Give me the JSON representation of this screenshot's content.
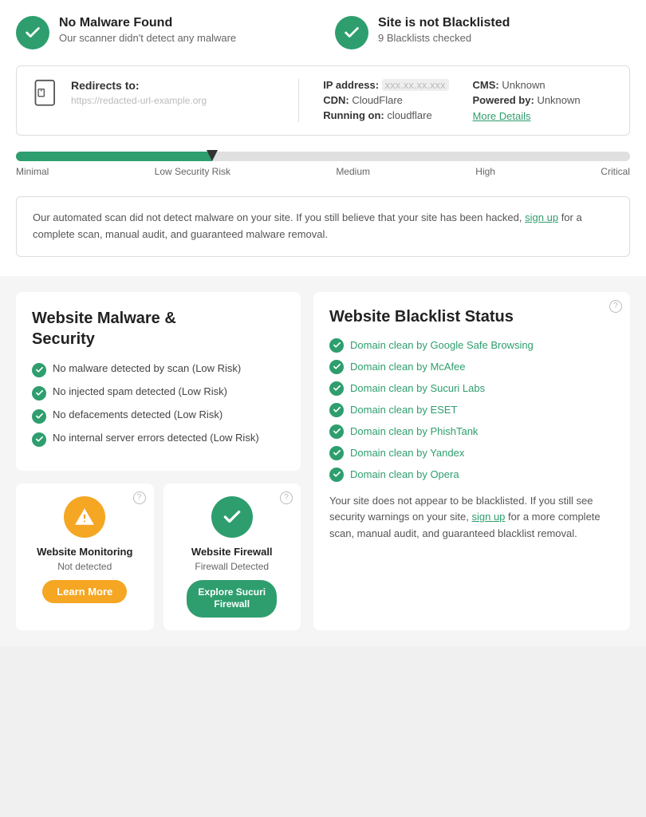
{
  "status_cards": [
    {
      "id": "no-malware",
      "title": "No Malware Found",
      "description": "Our scanner didn't detect any malware"
    },
    {
      "id": "not-blacklisted",
      "title": "Site is not Blacklisted",
      "description": "9 Blacklists checked"
    }
  ],
  "info_box": {
    "redirects_label": "Redirects to:",
    "redirects_url": "https://redacted-url-example.org",
    "ip_label": "IP address:",
    "ip_value": "xxx.xx.xx.xxx",
    "cdn_label": "CDN:",
    "cdn_value": "CloudFlare",
    "running_label": "Running on:",
    "running_value": "cloudflare",
    "cms_label": "CMS:",
    "cms_value": "Unknown",
    "powered_label": "Powered by:",
    "powered_value": "Unknown",
    "more_details": "More Details"
  },
  "risk_meter": {
    "labels": [
      "Minimal",
      "Low Security Risk",
      "Medium",
      "High",
      "Critical"
    ],
    "fill_percent": 32
  },
  "scan_message": {
    "text_before": "Our automated scan did not detect malware on your site. If you still believe that your site has been hacked,",
    "link_text": "sign up",
    "text_after": "for a complete scan, manual audit, and guaranteed malware removal."
  },
  "security_section": {
    "title": "Website Malware &\nSecurity",
    "items": [
      "No malware detected by scan (Low Risk)",
      "No injected spam detected (Low Risk)",
      "No defacements detected (Low Risk)",
      "No internal server errors detected (Low Risk)"
    ]
  },
  "monitoring_card": {
    "title": "Website Monitoring",
    "status": "Not detected",
    "button_label": "Learn More"
  },
  "firewall_card": {
    "title": "Website Firewall",
    "status": "Firewall Detected",
    "button_label": "Explore Sucuri\nFirewall"
  },
  "blacklist_section": {
    "title": "Website Blacklist Status",
    "items": [
      "Domain clean by Google Safe Browsing",
      "Domain clean by McAfee",
      "Domain clean by Sucuri Labs",
      "Domain clean by ESET",
      "Domain clean by PhishTank",
      "Domain clean by Yandex",
      "Domain clean by Opera"
    ],
    "note_before": "Your site does not appear to be blacklisted. If you still see security warnings on your site,",
    "note_link": "sign up",
    "note_after": "for a more complete scan, manual audit, and guaranteed blacklist removal."
  }
}
